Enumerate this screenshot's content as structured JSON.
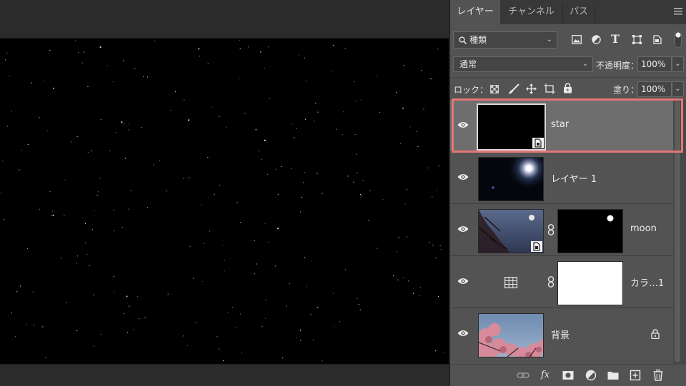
{
  "panel": {
    "tabs": [
      {
        "label": "レイヤー",
        "active": true
      },
      {
        "label": "チャンネル",
        "active": false
      },
      {
        "label": "パス",
        "active": false
      }
    ],
    "filter": {
      "value": "種類",
      "icons": [
        "image-filter-icon",
        "adjustment-filter-icon",
        "type-filter-icon",
        "shape-filter-icon",
        "smart-object-filter-icon",
        "filter-toggle"
      ]
    },
    "blend": {
      "mode": "通常",
      "opacity_label": "不透明度：",
      "opacity": "100%"
    },
    "lock": {
      "label": "ロック：",
      "fill_label": "塗り：",
      "fill": "100%"
    },
    "layers": [
      {
        "name": "star",
        "selected": true,
        "type": "smart-object"
      },
      {
        "name": "レイヤー 1",
        "selected": false,
        "type": "pixel"
      },
      {
        "name": "moon",
        "selected": false,
        "type": "smart-object-with-mask"
      },
      {
        "name": "カラ…1",
        "selected": false,
        "type": "fill-layer-with-mask"
      },
      {
        "name": "背景",
        "selected": false,
        "type": "background",
        "locked": true
      }
    ],
    "footer_icons": [
      "link-icon",
      "fx-icon",
      "mask-icon",
      "adjustment-icon",
      "folder-icon",
      "new-layer-icon",
      "trash-icon"
    ]
  },
  "colors": {
    "highlight": "#e47676",
    "panel_bg": "#535353",
    "selected_row": "#6e6e6e"
  }
}
